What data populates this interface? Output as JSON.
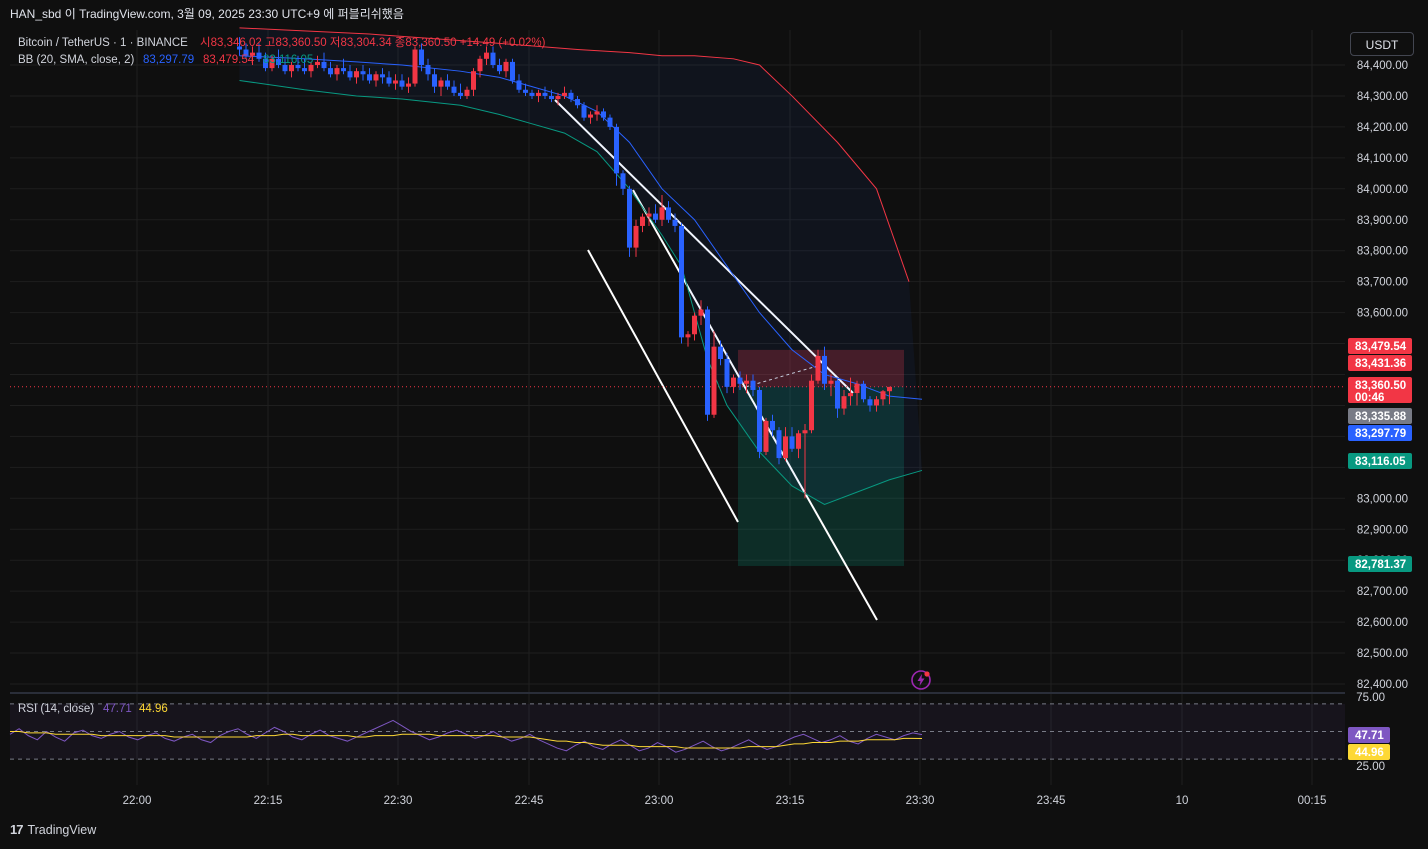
{
  "header": {
    "title": "HAN_sbd 이 TradingView.com, 3월 09, 2025 23:30 UTC+9 에 퍼블리쉬했음"
  },
  "legend": {
    "symbol": "Bitcoin / TetherUS · 1 · BINANCE",
    "ohlc": "시83,346.02 고83,360.50 저83,304.34 종83,360.50 +14.49 (+0.02%)",
    "bb_label": "BB (20, SMA, close, 2)",
    "bb_basis": "83,297.79",
    "bb_upper": "83,479.54",
    "bb_lower": "83,116.05",
    "rsi_label": "RSI (14, close)",
    "rsi_value": "47.71",
    "rsi_ma": "44.96"
  },
  "currency_button": "USDT",
  "footer": {
    "brand": "TradingView",
    "mark": "17"
  },
  "colors": {
    "up": "#f23645",
    "down": "#2962ff",
    "bb_upper": "#f23645",
    "bb_basis": "#2962ff",
    "bb_lower": "#089981",
    "rsi": "#7e57c2",
    "rsi_ma": "#fdd835",
    "bg": "#0f0f0f"
  },
  "icons": {
    "bolt": "lightning-bolt-icon",
    "logo": "tradingview-logo-icon"
  },
  "chart_data": {
    "type": "candlestick",
    "symbol": "BTCUSDT",
    "interval": "1m",
    "y_ticks": [
      84400,
      84300,
      84200,
      84100,
      84000,
      83900,
      83800,
      83700,
      83600,
      83000,
      82900,
      82800,
      82700,
      82600,
      82500,
      82400
    ],
    "y_tick_labels": [
      "84,400.00",
      "84,300.00",
      "84,200.00",
      "84,100.00",
      "84,000.00",
      "83,900.00",
      "83,800.00",
      "83,700.00",
      "83,600.00",
      "83,000.00",
      "82,900.00",
      "82,800.00",
      "82,700.00",
      "82,600.00",
      "82,500.00",
      "82,400.00"
    ],
    "x_ticks": [
      "22:00",
      "22:15",
      "22:30",
      "22:45",
      "23:00",
      "23:15",
      "23:30",
      "23:45",
      "10",
      "00:15"
    ],
    "price_tags": [
      {
        "label": "83,479.54",
        "value": 83479.54,
        "color": "#f23645"
      },
      {
        "label": "83,431.36",
        "value": 83431.36,
        "color": "#f23645"
      },
      {
        "label": "83,360.50",
        "value": 83360.5,
        "color": "#f23645",
        "sub": "00:46"
      },
      {
        "label": "83,335.88",
        "value": 83335.88,
        "color": "#787b86"
      },
      {
        "label": "83,297.79",
        "value": 83297.79,
        "color": "#2962ff"
      },
      {
        "label": "83,116.05",
        "value": 83116.05,
        "color": "#089981"
      },
      {
        "label": "82,781.37",
        "value": 82781.37,
        "color": "#089981"
      }
    ],
    "last_price": 83360.5,
    "candles": [
      [
        84460,
        84490,
        84430,
        84450
      ],
      [
        84450,
        84470,
        84420,
        84430
      ],
      [
        84430,
        84460,
        84400,
        84440
      ],
      [
        84440,
        84470,
        84410,
        84420
      ],
      [
        84420,
        84440,
        84380,
        84390
      ],
      [
        84390,
        84430,
        84380,
        84420
      ],
      [
        84420,
        84450,
        84390,
        84400
      ],
      [
        84400,
        84420,
        84370,
        84380
      ],
      [
        84380,
        84410,
        84360,
        84400
      ],
      [
        84400,
        84430,
        84380,
        84390
      ],
      [
        84390,
        84420,
        84370,
        84380
      ],
      [
        84380,
        84410,
        84360,
        84400
      ],
      [
        84400,
        84430,
        84390,
        84410
      ],
      [
        84410,
        84440,
        84380,
        84390
      ],
      [
        84390,
        84410,
        84360,
        84370
      ],
      [
        84370,
        84400,
        84350,
        84390
      ],
      [
        84390,
        84420,
        84370,
        84380
      ],
      [
        84380,
        84400,
        84350,
        84360
      ],
      [
        84360,
        84390,
        84340,
        84380
      ],
      [
        84380,
        84400,
        84350,
        84370
      ],
      [
        84370,
        84390,
        84340,
        84350
      ],
      [
        84350,
        84380,
        84330,
        84370
      ],
      [
        84370,
        84390,
        84340,
        84360
      ],
      [
        84360,
        84380,
        84330,
        84340
      ],
      [
        84340,
        84370,
        84320,
        84350
      ],
      [
        84350,
        84370,
        84320,
        84330
      ],
      [
        84330,
        84360,
        84310,
        84340
      ],
      [
        84340,
        84460,
        84330,
        84450
      ],
      [
        84450,
        84470,
        84380,
        84400
      ],
      [
        84400,
        84420,
        84350,
        84370
      ],
      [
        84370,
        84390,
        84310,
        84330
      ],
      [
        84330,
        84360,
        84300,
        84350
      ],
      [
        84350,
        84370,
        84320,
        84330
      ],
      [
        84330,
        84350,
        84300,
        84310
      ],
      [
        84310,
        84340,
        84290,
        84300
      ],
      [
        84300,
        84330,
        84290,
        84320
      ],
      [
        84320,
        84390,
        84300,
        84380
      ],
      [
        84380,
        84430,
        84360,
        84420
      ],
      [
        84420,
        84460,
        84400,
        84440
      ],
      [
        84440,
        84460,
        84390,
        84400
      ],
      [
        84400,
        84420,
        84370,
        84380
      ],
      [
        84380,
        84420,
        84360,
        84410
      ],
      [
        84410,
        84420,
        84340,
        84350
      ],
      [
        84350,
        84370,
        84310,
        84320
      ],
      [
        84320,
        84340,
        84300,
        84310
      ],
      [
        84310,
        84320,
        84290,
        84300
      ],
      [
        84300,
        84320,
        84280,
        84310
      ],
      [
        84310,
        84330,
        84290,
        84300
      ],
      [
        84300,
        84320,
        84280,
        84290
      ],
      [
        84290,
        84310,
        84270,
        84300
      ],
      [
        84300,
        84330,
        84290,
        84310
      ],
      [
        84310,
        84320,
        84280,
        84290
      ],
      [
        84290,
        84300,
        84260,
        84270
      ],
      [
        84270,
        84280,
        84220,
        84230
      ],
      [
        84230,
        84250,
        84210,
        84240
      ],
      [
        84240,
        84270,
        84220,
        84250
      ],
      [
        84250,
        84260,
        84220,
        84230
      ],
      [
        84230,
        84240,
        84190,
        84200
      ],
      [
        84200,
        84210,
        84010,
        84050
      ],
      [
        84050,
        84060,
        83980,
        84000
      ],
      [
        84000,
        84010,
        83780,
        83810
      ],
      [
        83810,
        83900,
        83780,
        83880
      ],
      [
        83880,
        83920,
        83860,
        83910
      ],
      [
        83910,
        83940,
        83880,
        83920
      ],
      [
        83920,
        83950,
        83890,
        83900
      ],
      [
        83900,
        83980,
        83880,
        83940
      ],
      [
        83940,
        83960,
        83890,
        83900
      ],
      [
        83900,
        83920,
        83860,
        83880
      ],
      [
        83880,
        83890,
        83500,
        83520
      ],
      [
        83520,
        83540,
        83490,
        83530
      ],
      [
        83530,
        83600,
        83510,
        83590
      ],
      [
        83590,
        83640,
        83560,
        83610
      ],
      [
        83610,
        83620,
        83250,
        83270
      ],
      [
        83270,
        83540,
        83260,
        83490
      ],
      [
        83490,
        83510,
        83430,
        83450
      ],
      [
        83450,
        83470,
        83340,
        83360
      ],
      [
        83360,
        83400,
        83340,
        83390
      ],
      [
        83390,
        83410,
        83350,
        83370
      ],
      [
        83370,
        83400,
        83340,
        83380
      ],
      [
        83380,
        83400,
        83330,
        83350
      ],
      [
        83350,
        83360,
        83130,
        83150
      ],
      [
        83150,
        83260,
        83140,
        83250
      ],
      [
        83250,
        83270,
        83200,
        83220
      ],
      [
        83220,
        83230,
        83110,
        83130
      ],
      [
        83130,
        83230,
        83120,
        83200
      ],
      [
        83200,
        83230,
        83150,
        83160
      ],
      [
        83160,
        83220,
        83130,
        83210
      ],
      [
        83210,
        83240,
        83000,
        83220
      ],
      [
        83220,
        83400,
        83210,
        83380
      ],
      [
        83380,
        83480,
        83370,
        83460
      ],
      [
        83460,
        83490,
        83350,
        83370
      ],
      [
        83370,
        83400,
        83330,
        83380
      ],
      [
        83380,
        83390,
        83260,
        83290
      ],
      [
        83290,
        83350,
        83270,
        83330
      ],
      [
        83330,
        83390,
        83300,
        83340
      ],
      [
        83340,
        83380,
        83300,
        83370
      ],
      [
        83370,
        83380,
        83310,
        83320
      ],
      [
        83320,
        83330,
        83280,
        83300
      ],
      [
        83300,
        83330,
        83280,
        83320
      ],
      [
        83320,
        83350,
        83300,
        83346
      ],
      [
        83346,
        83360,
        83304,
        83360
      ]
    ],
    "bollinger": {
      "upper_path": [
        [
          84520,
          0
        ],
        [
          84500,
          20
        ],
        [
          84470,
          40
        ],
        [
          84450,
          52
        ],
        [
          84440,
          60
        ],
        [
          84430,
          65
        ],
        [
          84430,
          70
        ],
        [
          84420,
          76
        ],
        [
          84400,
          80
        ],
        [
          84300,
          85
        ],
        [
          84150,
          92
        ],
        [
          84000,
          98
        ],
        [
          83700,
          103
        ],
        [
          83560,
          110
        ],
        [
          83530,
          115
        ],
        [
          83495,
          124
        ],
        [
          83480,
          130
        ]
      ],
      "basis_path": [
        [
          84430,
          0
        ],
        [
          84420,
          10
        ],
        [
          84410,
          18
        ],
        [
          84400,
          25
        ],
        [
          84380,
          34
        ],
        [
          84360,
          40
        ],
        [
          84330,
          45
        ],
        [
          84300,
          50
        ],
        [
          84250,
          55
        ],
        [
          84150,
          60
        ],
        [
          84000,
          65
        ],
        [
          83900,
          70
        ],
        [
          83750,
          75
        ],
        [
          83600,
          80
        ],
        [
          83480,
          85
        ],
        [
          83400,
          90
        ],
        [
          83370,
          95
        ],
        [
          83330,
          100
        ],
        [
          83320,
          105
        ],
        [
          83310,
          112
        ],
        [
          83298,
          130
        ]
      ],
      "lower_path": [
        [
          84350,
          0
        ],
        [
          84320,
          10
        ],
        [
          84300,
          18
        ],
        [
          84290,
          25
        ],
        [
          84270,
          34
        ],
        [
          84240,
          40
        ],
        [
          84210,
          45
        ],
        [
          84180,
          50
        ],
        [
          84120,
          55
        ],
        [
          84000,
          60
        ],
        [
          83850,
          65
        ],
        [
          83750,
          68
        ],
        [
          83600,
          70
        ],
        [
          83450,
          72
        ],
        [
          83300,
          75
        ],
        [
          83150,
          80
        ],
        [
          83040,
          85
        ],
        [
          82980,
          90
        ],
        [
          83020,
          95
        ],
        [
          83060,
          100
        ],
        [
          83090,
          105
        ],
        [
          83110,
          112
        ],
        [
          83116,
          130
        ]
      ]
    },
    "rsi": {
      "ylim": [
        25,
        75
      ],
      "levels": [
        70,
        50,
        30
      ],
      "tick_labels": [
        "75.00",
        "25.00"
      ],
      "values": [
        48,
        52,
        47,
        44,
        50,
        46,
        43,
        49,
        51,
        47,
        45,
        48,
        50,
        46,
        44,
        47,
        49,
        45,
        43,
        46,
        48,
        44,
        42,
        47,
        50,
        52,
        48,
        45,
        49,
        53,
        50,
        46,
        44,
        48,
        51,
        47,
        45,
        43,
        46,
        49,
        52,
        55,
        58,
        54,
        50,
        47,
        44,
        46,
        49,
        51,
        48,
        45,
        47,
        50,
        46,
        43,
        45,
        48,
        44,
        41,
        38,
        36,
        40,
        43,
        39,
        37,
        41,
        44,
        40,
        36,
        38,
        42,
        39,
        35,
        37,
        40,
        43,
        39,
        36,
        38,
        41,
        44,
        40,
        37,
        39,
        43,
        46,
        48,
        45,
        42,
        44,
        47,
        43,
        41,
        45,
        48,
        46,
        44,
        47,
        49,
        47.71
      ],
      "ma_values": [
        50,
        50,
        49,
        49,
        49,
        48,
        48,
        48,
        48,
        48,
        47,
        47,
        47,
        47,
        47,
        47,
        47,
        47,
        46,
        46,
        46,
        46,
        46,
        46,
        46,
        46,
        46,
        47,
        47,
        47,
        48,
        48,
        47,
        47,
        47,
        47,
        47,
        47,
        46,
        46,
        47,
        47,
        47,
        48,
        48,
        48,
        48,
        47,
        47,
        47,
        47,
        47,
        47,
        47,
        46,
        46,
        46,
        46,
        45,
        44,
        43,
        43,
        42,
        42,
        41,
        40,
        40,
        40,
        40,
        39,
        39,
        39,
        39,
        39,
        38,
        38,
        38,
        38,
        38,
        38,
        38,
        39,
        39,
        39,
        39,
        40,
        41,
        41,
        42,
        42,
        42,
        43,
        43,
        43,
        44,
        44,
        44,
        44,
        45,
        45,
        44.96
      ]
    }
  }
}
